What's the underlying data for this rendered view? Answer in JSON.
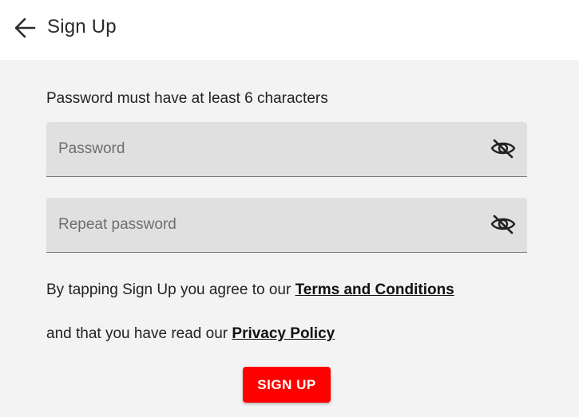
{
  "appbar": {
    "back_icon": "arrow-left-icon",
    "title": "Sign Up"
  },
  "form": {
    "hint": "Password must have at least 6 characters",
    "password": {
      "value": "",
      "placeholder": "Password",
      "visibility_icon": "eye-off-icon"
    },
    "repeat_password": {
      "value": "",
      "placeholder": "Repeat password",
      "visibility_icon": "eye-off-icon"
    }
  },
  "agreement": {
    "line1_text": "By tapping Sign Up you agree to our ",
    "terms_link": "Terms and Conditions",
    "line2_text": "and that you have read our ",
    "privacy_link": "Privacy Policy"
  },
  "signup_button": {
    "label": "SIGN UP",
    "color": "#ff0000"
  },
  "colors": {
    "background": "#f3f3f3",
    "appbar": "#ffffff",
    "field_fill": "#e0e0e0"
  }
}
